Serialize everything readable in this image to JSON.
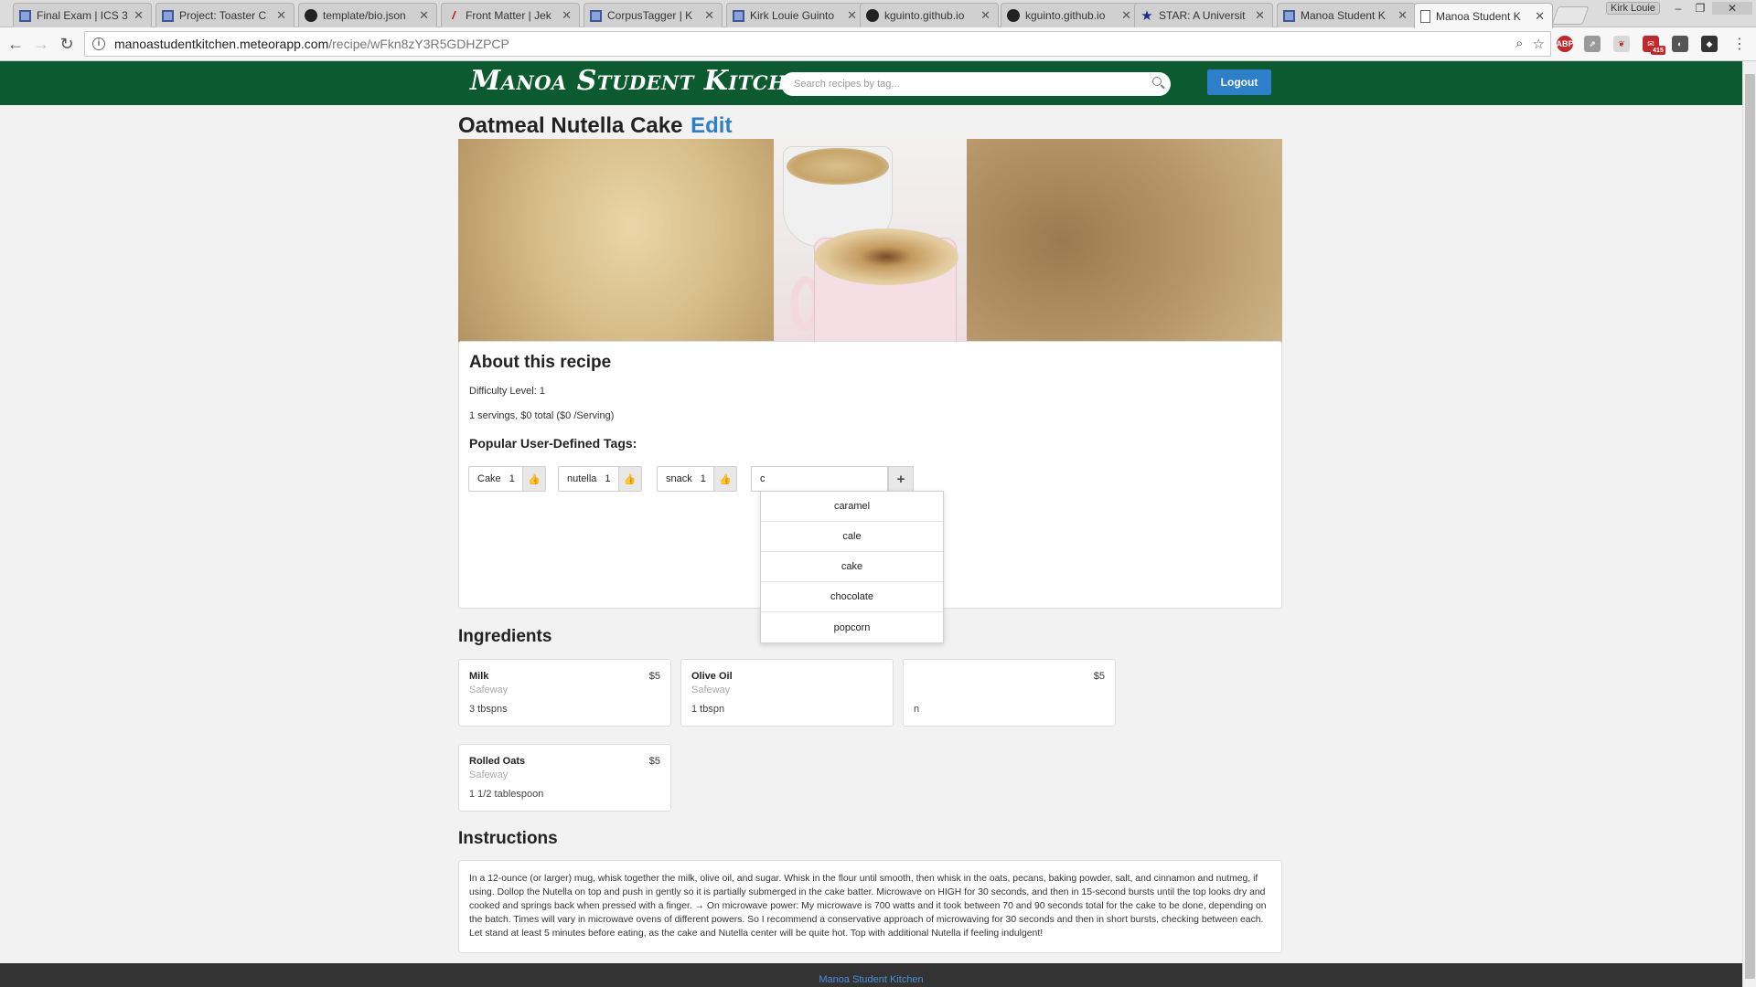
{
  "browser": {
    "tabs": [
      {
        "title": "Final Exam | ICS 3",
        "icon": "doc-icon",
        "active": false
      },
      {
        "title": "Project: Toaster C",
        "icon": "doc-icon",
        "active": false
      },
      {
        "title": "template/bio.json",
        "icon": "github-icon",
        "active": false
      },
      {
        "title": "Front Matter | Jek",
        "icon": "jekyll-icon",
        "active": false
      },
      {
        "title": "CorpusTagger | K",
        "icon": "doc-icon",
        "active": false
      },
      {
        "title": "Kirk Louie Guinto",
        "icon": "doc-icon",
        "active": false
      },
      {
        "title": "kguinto.github.io",
        "icon": "github-icon",
        "active": false
      },
      {
        "title": "kguinto.github.io",
        "icon": "github-icon",
        "active": false
      },
      {
        "title": "STAR: A Universit",
        "icon": "star-icon",
        "active": false
      },
      {
        "title": "Manoa Student K",
        "icon": "doc-icon",
        "active": false
      },
      {
        "title": "Manoa Student K",
        "icon": "page-icon",
        "active": true
      }
    ],
    "profile_name": "Kirk Louie",
    "url_host": "manoastudentkitchen.meteorapp.com",
    "url_path": "/recipe/wFkn8zY3R5GDHZPCP",
    "gmail_badge": "415"
  },
  "site": {
    "brand": "Manoa Student Kitchen",
    "search_placeholder": "Search recipes by tag...",
    "logout_label": "Logout",
    "accent_color": "#0c5a2f",
    "link_color": "#2e7fc9"
  },
  "recipe": {
    "title": "Oatmeal Nutella Cake",
    "edit_label": "Edit",
    "about_heading": "About this recipe",
    "difficulty": "Difficulty Level: 1",
    "servings_cost": "1 servings, $0 total ($0 /Serving)",
    "tags_heading": "Popular User-Defined Tags:",
    "tags": [
      {
        "name": "Cake",
        "count": "1"
      },
      {
        "name": "nutella",
        "count": "1"
      },
      {
        "name": "snack",
        "count": "1"
      }
    ],
    "tag_input_value": "c",
    "tag_suggestions": [
      "caramel",
      "cale",
      "cake",
      "chocolate",
      "popcorn"
    ],
    "ingredients_heading": "Ingredients",
    "ingredients": [
      {
        "name": "Milk",
        "price": "$5",
        "store": "Safeway",
        "qty": "3 tbspns"
      },
      {
        "name": "Olive Oil",
        "price": "",
        "store": "Safeway",
        "qty": "1 tbspn"
      },
      {
        "name": "",
        "price": "$5",
        "store": "",
        "qty": "n"
      },
      {
        "name": "Rolled Oats",
        "price": "$5",
        "store": "Safeway",
        "qty": "1 1/2 tablespoon"
      }
    ],
    "instructions_heading": "Instructions",
    "instructions": "In a 12-ounce (or larger) mug, whisk together the milk, olive oil, and sugar. Whisk in the flour until smooth, then whisk in the oats, pecans, baking powder, salt, and cinnamon and nutmeg, if using. Dollop the Nutella on top and push in gently so it is partially submerged in the cake batter. Microwave on HIGH for 30 seconds, and then in 15-second bursts until the top looks dry and cooked and springs back when pressed with a finger. → On microwave power: My microwave is 700 watts and it took between 70 and 90 seconds total for the cake to be done, depending on the batch. Times will vary in microwave ovens of different powers. So I recommend a conservative approach of microwaving for 30 seconds and then in short bursts, checking between each. Let stand at least 5 minutes before eating, as the cake and Nutella center will be quite hot. Top with additional Nutella if feeling indulgent!"
  },
  "footer": {
    "link": "Manoa Student Kitchen"
  }
}
